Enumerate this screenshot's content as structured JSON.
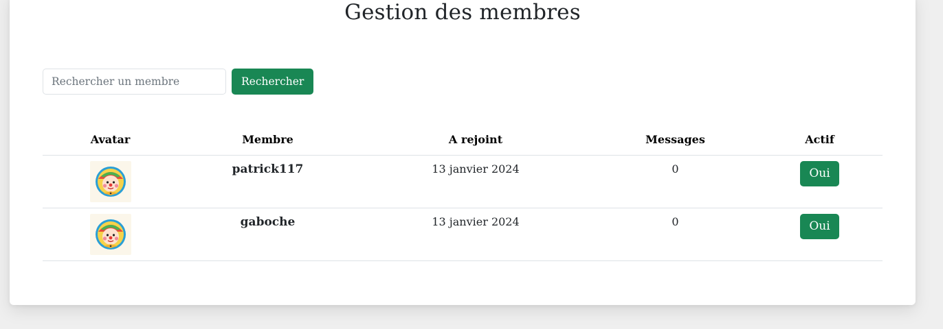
{
  "page": {
    "title": "Gestion des membres"
  },
  "search": {
    "placeholder": "Rechercher un membre",
    "value": "",
    "button_label": "Rechercher"
  },
  "table": {
    "headers": {
      "avatar": "Avatar",
      "member": "Membre",
      "joined": "A rejoint",
      "messages": "Messages",
      "active": "Actif"
    },
    "rows": [
      {
        "avatar_icon": "clown-avatar-icon",
        "member": "patrick117",
        "joined": "13 janvier 2024",
        "messages": "0",
        "active": "Oui"
      },
      {
        "avatar_icon": "clown-avatar-icon",
        "member": "gaboche",
        "joined": "13 janvier 2024",
        "messages": "0",
        "active": "Oui"
      }
    ]
  },
  "colors": {
    "accent": "#198754",
    "page_background": "#efefef",
    "card_background": "#ffffff",
    "border": "#dee2e6"
  }
}
